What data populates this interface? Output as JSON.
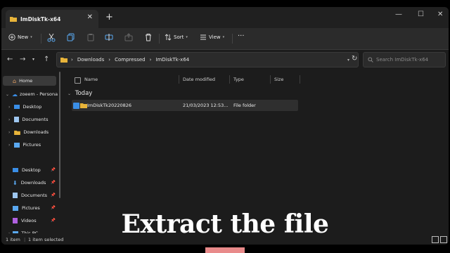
{
  "window": {
    "tab_title": "ImDiskTk-x64",
    "close_glyph": "✕",
    "new_tab_glyph": "+",
    "minimize_glyph": "—",
    "maximize_glyph": "☐",
    "window_close_glyph": "✕"
  },
  "toolbar": {
    "new_label": "New",
    "sort_label": "Sort",
    "view_label": "View",
    "more_label": "···",
    "icons": [
      "cut-icon",
      "copy-icon",
      "paste-icon",
      "rename-icon",
      "share-icon",
      "delete-icon"
    ]
  },
  "address": {
    "crumbs": [
      "Downloads",
      "Compressed",
      "ImDiskTk-x64"
    ],
    "separator": "›",
    "search_placeholder": "Search ImDiskTk-x64"
  },
  "sidebar": {
    "home": "Home",
    "onedrive": "zoeem - Persona",
    "tree": [
      "Desktop",
      "Documents",
      "Downloads",
      "Pictures"
    ],
    "quick": [
      "Desktop",
      "Downloads",
      "Documents",
      "Pictures",
      "Videos"
    ],
    "this_pc": "This PC"
  },
  "columns": {
    "name": "Name",
    "date": "Date modified",
    "type": "Type",
    "size": "Size"
  },
  "group_label": "Today",
  "files": [
    {
      "name": "ImDiskTk20220826",
      "date": "21/03/2023 12:53...",
      "type": "File folder",
      "size": ""
    }
  ],
  "status": {
    "count": "1 item",
    "selected": "1 item selected"
  },
  "caption": "Extract the file",
  "colors": {
    "folder": "#e8b43a",
    "accent": "#3a8ee6",
    "caption_bar": "#e88a8a"
  }
}
